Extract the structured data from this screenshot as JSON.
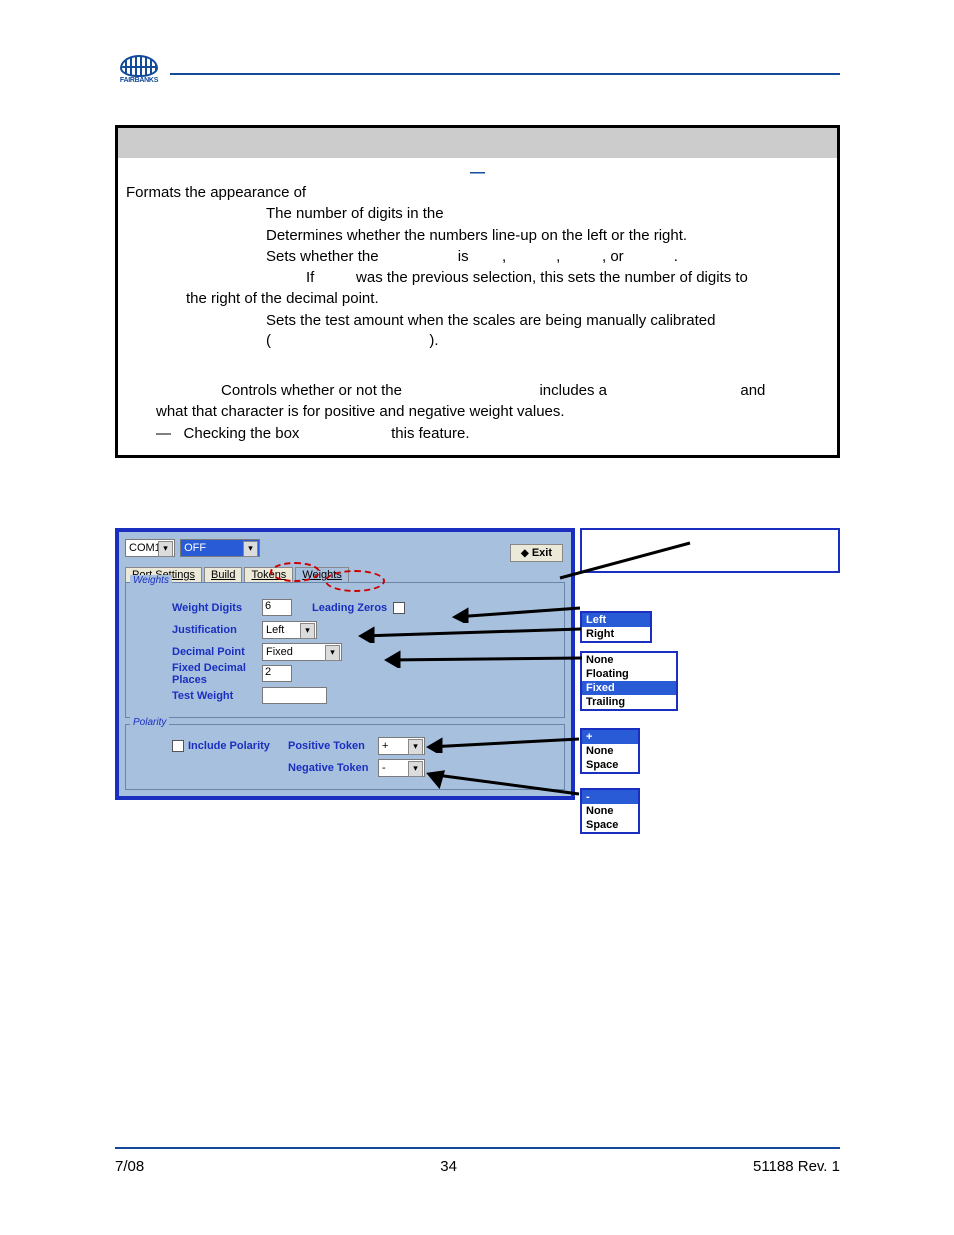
{
  "logo_text": "FAIRBANKS",
  "desc": {
    "l1": "Formats the appearance of",
    "l2": "The number of digits in the",
    "l3": "Determines whether the numbers line-up on the left or the right.",
    "l4a": "Sets whether the",
    "l4b": "is",
    "l4c": ",",
    "l4d": ",",
    "l4e": ", or",
    "l4f": ".",
    "l5a": "If",
    "l5b": "was the previous selection, this sets the number of digits to",
    "l5c": "the right of the decimal point.",
    "l6a": "Sets the test amount when the scales are being manually calibrated (",
    "l6b": ").",
    "l7a": "Controls whether or not the",
    "l7b": "includes a",
    "l7c": "and",
    "l7d": "what that character is for positive and negative weight values.",
    "l8a": "—",
    "l8b": "Checking the box",
    "l8c": "this feature."
  },
  "win": {
    "combo1": "COM1",
    "combo2": "OFF",
    "exit": "Exit",
    "tabs": {
      "port": "Port Settings",
      "build": "Build",
      "tokens": "Tokens",
      "weights": "Weights"
    },
    "section_weights": "Weights",
    "section_polarity": "Polarity",
    "labels": {
      "weight_digits": "Weight Digits",
      "leading_zeros": "Leading Zeros",
      "justification": "Justification",
      "decimal_point": "Decimal Point",
      "fixed_decimal": "Fixed Decimal Places",
      "test_weight": "Test Weight",
      "include_polarity": "Include Polarity",
      "positive_token": "Positive Token",
      "negative_token": "Negative Token"
    },
    "values": {
      "weight_digits": "6",
      "justification": "Left",
      "decimal_point": "Fixed",
      "fixed_decimal": "2",
      "test_weight": "",
      "positive_token": "+",
      "negative_token": "-"
    }
  },
  "callouts": {
    "justification": [
      "Left",
      "Right"
    ],
    "decimal": [
      "None",
      "Floating",
      "Fixed",
      "Trailing"
    ],
    "positive": [
      "+",
      "None",
      "Space"
    ],
    "negative": [
      "-",
      "None",
      "Space"
    ]
  },
  "footer": {
    "left": "7/08",
    "center": "34",
    "right": "51188    Rev. 1"
  }
}
